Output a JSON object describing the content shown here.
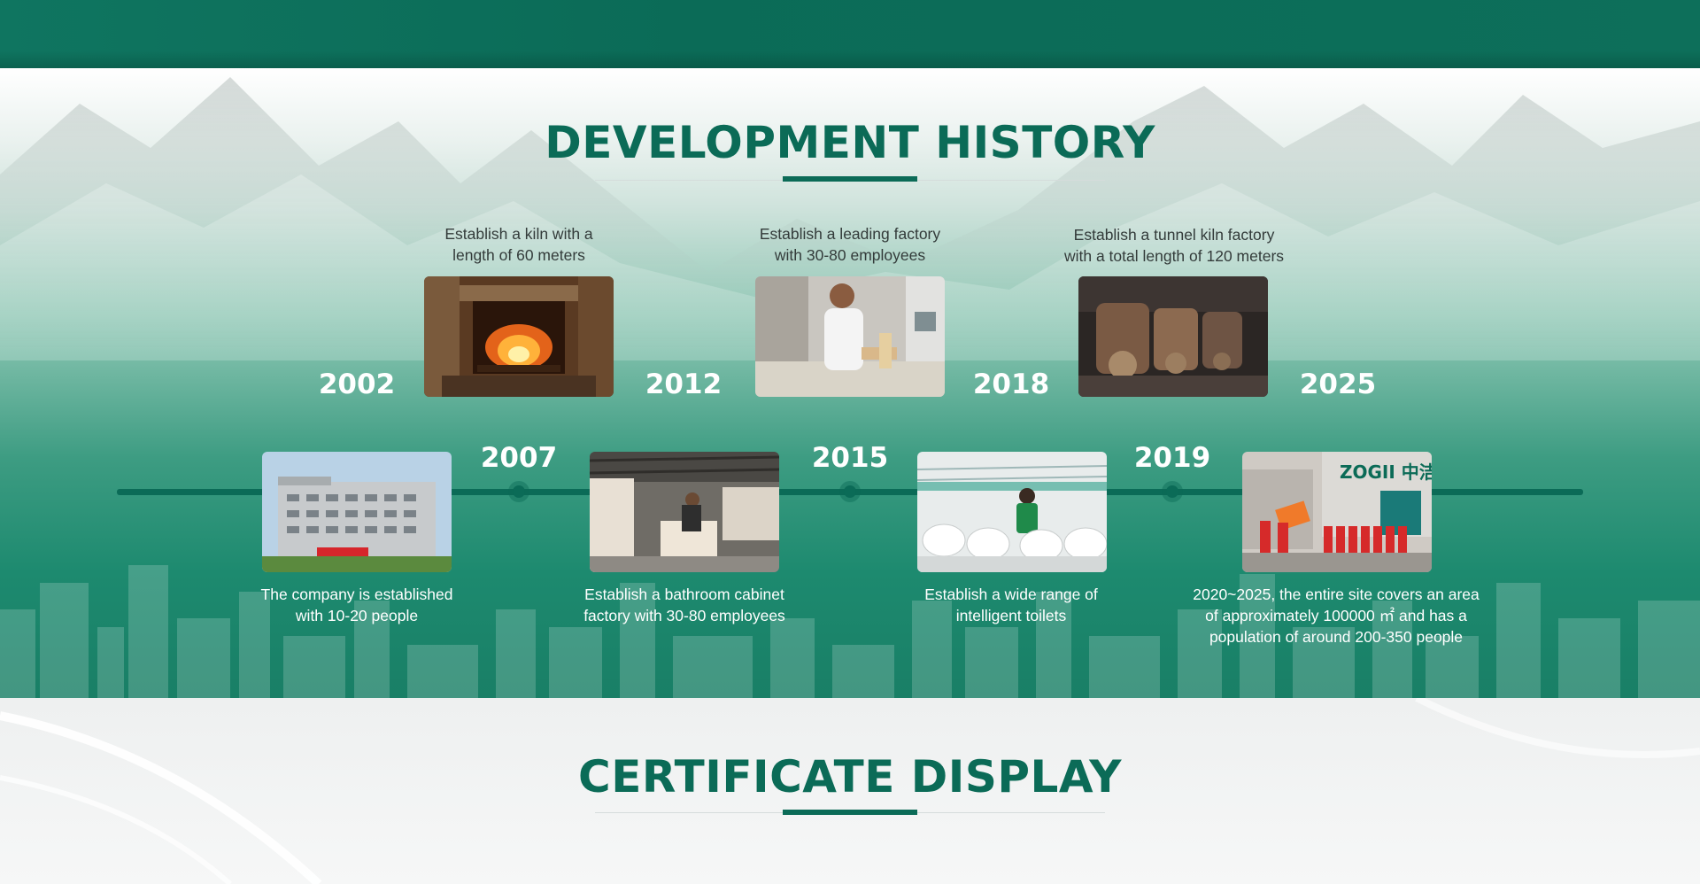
{
  "history": {
    "title": "DEVELOPMENT HISTORY",
    "milestones_top": [
      {
        "year": "2007",
        "caption_line1": "Establish a kiln with a",
        "caption_line2": "length of 60 meters",
        "photo": "kiln-fireplace-photo"
      },
      {
        "year": "2015",
        "caption_line1": "Establish a leading factory",
        "caption_line2": "with 30-80 employees",
        "photo": "factory-worker-photo"
      },
      {
        "year": "2019",
        "caption_line1": "Establish a tunnel kiln factory",
        "caption_line2": "with a total length of 120 meters",
        "photo": "tunnel-kiln-machinery-photo"
      }
    ],
    "milestones_bottom": [
      {
        "year": "2002",
        "caption_line1": "The company is established",
        "caption_line2": "with 10-20 people",
        "caption_line3": "",
        "photo": "company-building-photo"
      },
      {
        "year": "2012",
        "caption_line1": "Establish a bathroom cabinet",
        "caption_line2": "factory with 30-80 employees",
        "caption_line3": "",
        "photo": "cabinet-workshop-photo"
      },
      {
        "year": "2018",
        "caption_line1": "Establish a wide range of",
        "caption_line2": "intelligent toilets",
        "caption_line3": "",
        "photo": "toilet-production-photo"
      },
      {
        "year": "2025",
        "caption_line1": "2020~2025, the entire site covers an area",
        "caption_line2": "of approximately 100000 ㎡ and has a",
        "caption_line3": "population of around 200-350 people",
        "photo": "team-storefront-photo",
        "sign_text": "ZOGII 中洁"
      }
    ]
  },
  "certificate": {
    "title": "CERTIFICATE DISPLAY"
  },
  "colors": {
    "brand_green": "#0b6b57",
    "caption_dark": "#333b3a",
    "caption_light": "#ffffff"
  }
}
